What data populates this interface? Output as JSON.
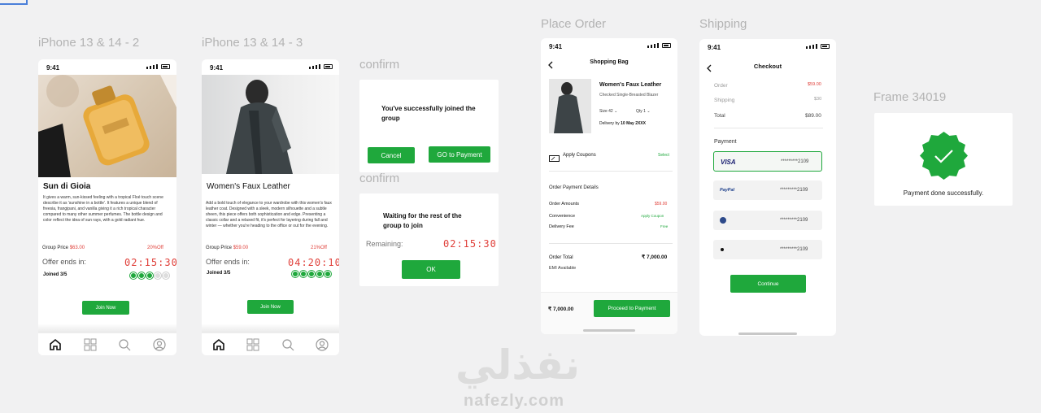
{
  "frame_labels": {
    "iphone2": "iPhone 13 & 14 - 2",
    "iphone3": "iPhone 13 & 14 - 3",
    "confirm1": "confirm",
    "confirm2": "confirm",
    "place_order": "Place Order",
    "shipping": "Shipping",
    "frame34019": "Frame 34019"
  },
  "status_time": "9:41",
  "product1": {
    "title": "Sun di Gioia",
    "description": "It gives a warm, sun-kissed feeling with a tropical Floé touch scene describe it as 'sunshine in a bottle'. It features a unique blend of freesia, frangipani, and vanilla giving it a rich tropical character compared to many other summer perfumes. The bottle design and color reflect the idea of sun rays, with a gold radiant hue.",
    "group_price_label": "Group Price",
    "group_price": "$63.00",
    "discount": "20%Off",
    "offer_label": "Offer ends in:",
    "timer": "02:15:30",
    "joined": "Joined 3/5",
    "join_button": "Join Now"
  },
  "product2": {
    "title": "Women's Faux Leather",
    "description": "Add a bold touch of elegance to your wardrobe with this women's faux leather coat. Designed with a sleek, modern silhouette and a subtle sheen, this piece offers both sophistication and edge. Presenting a classic collar and a relaxed fit, it's perfect for layering during fall and winter — whether you're heading to the office or out for the evening.",
    "group_price_label": "Group Price",
    "group_price": "$59.00",
    "discount": "21%Off",
    "offer_label": "Offer ends in:",
    "timer": "04:20:10",
    "joined": "Joined 3/5",
    "join_button": "Join Now"
  },
  "confirm1": {
    "message": "You've successfully joined the group",
    "cancel": "Cancel",
    "pay": "GO to Payment"
  },
  "confirm2": {
    "message": "Waiting for the rest of the group to join",
    "remaining_label": "Remaining:",
    "timer": "02:15:30",
    "ok": "OK"
  },
  "bag": {
    "title": "Shopping Bag",
    "item_name": "Women's Faux Leather",
    "item_desc": "Checked Single-Breasted Blazer",
    "size_label": "Size",
    "size_value": "42",
    "qty_label": "Qty",
    "qty_value": "1",
    "delivery_label": "Delivery by",
    "delivery_date": "10 May 2XXX",
    "coupon_label": "Apply Coupons",
    "coupon_action": "Select",
    "details_title": "Order Payment Details",
    "order_amounts_label": "Order Amounts",
    "order_amounts": "$59.00",
    "convenience_label": "Convenience",
    "convenience_action": "Apply Coupon",
    "delivery_fee_label": "Delivery Fee",
    "delivery_fee": "Free",
    "total_label": "Order Total",
    "total_value": "7,000.00",
    "currency": "₹",
    "emi": "EMI Available",
    "footer_total": "₹ 7,000.00",
    "proceed": "Proceed to Payment"
  },
  "checkout": {
    "title": "Checkout",
    "order_label": "Order",
    "order_value": "$59.00",
    "shipping_label": "Shipping",
    "shipping_value": "$30",
    "total_label": "Total",
    "total_value": "$89.00",
    "payment_label": "Payment",
    "methods": [
      {
        "name": "VISA",
        "number": "*********2109"
      },
      {
        "name": "PayPal",
        "number": "*********2109"
      },
      {
        "name": "",
        "number": "*********2109"
      },
      {
        "name": "",
        "number": "*********2109"
      }
    ],
    "continue": "Continue"
  },
  "success": {
    "message": "Payment done successfully."
  },
  "watermark": {
    "arabic": "نفذلي",
    "latin": "nafezly.com"
  },
  "colors": {
    "accent_green": "#1fa83c",
    "price_red": "#e0403a"
  },
  "icons": [
    "home-icon",
    "grid-icon",
    "search-icon",
    "user-icon",
    "back-arrow-icon",
    "coupon-icon",
    "check-icon"
  ]
}
